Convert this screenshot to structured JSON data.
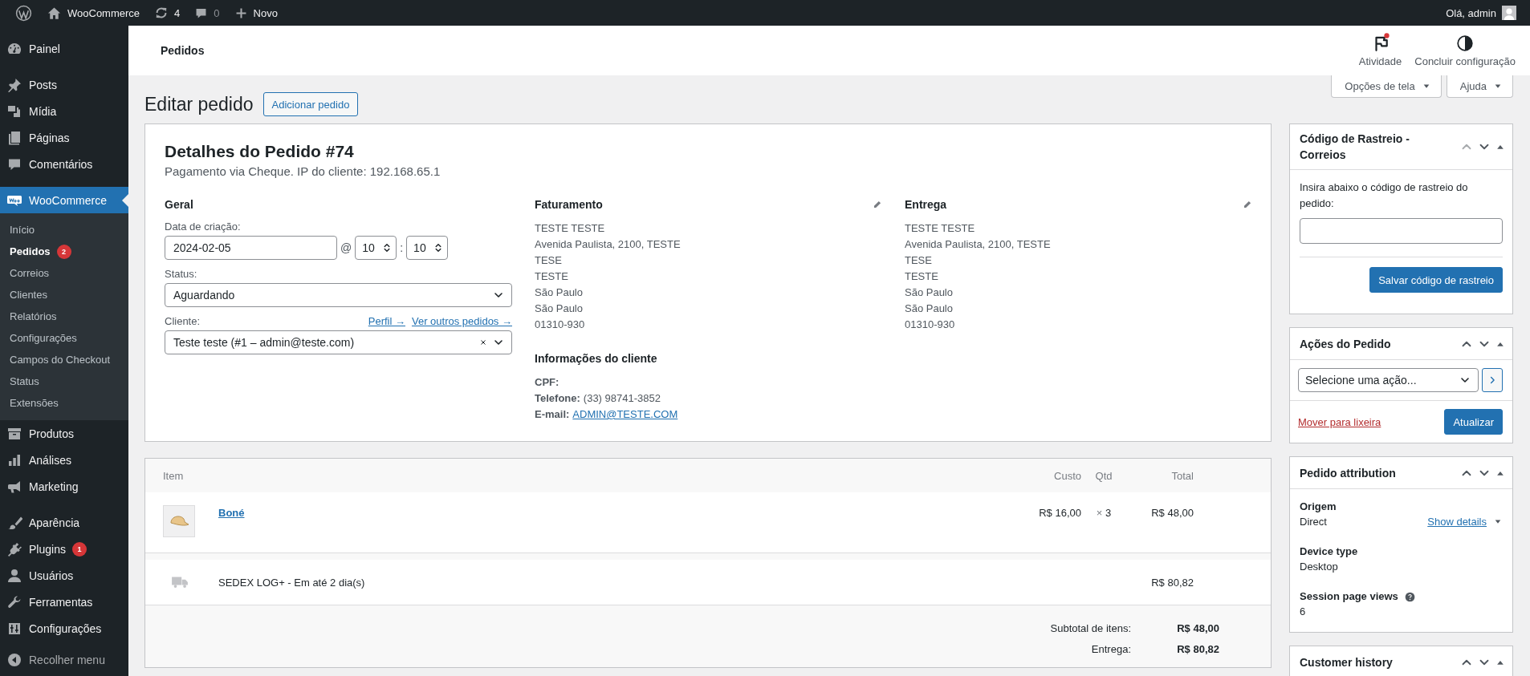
{
  "admin_bar": {
    "site_name": "WooCommerce",
    "updates": "4",
    "comments": "0",
    "new_label": "Novo",
    "greeting": "Olá, admin"
  },
  "menu_groups": [
    {
      "items": [
        {
          "label": "Painel",
          "selected": false
        }
      ]
    },
    {
      "items": [
        {
          "label": "Posts",
          "selected": false
        },
        {
          "label": "Mídia",
          "selected": false
        },
        {
          "label": "Páginas",
          "selected": false
        },
        {
          "label": "Comentários",
          "selected": false
        }
      ]
    },
    {
      "items": [
        {
          "label": "WooCommerce",
          "selected": true,
          "children": [
            {
              "label": "Início",
              "selected": false
            },
            {
              "label": "Pedidos",
              "selected": true,
              "badge": "2"
            },
            {
              "label": "Correios",
              "selected": false
            },
            {
              "label": "Clientes",
              "selected": false
            },
            {
              "label": "Relatórios",
              "selected": false
            },
            {
              "label": "Configurações",
              "selected": false
            },
            {
              "label": "Campos do Checkout",
              "selected": false
            },
            {
              "label": "Status",
              "selected": false
            },
            {
              "label": "Extensões",
              "selected": false
            }
          ]
        },
        {
          "label": "Produtos",
          "selected": false
        },
        {
          "label": "Análises",
          "selected": false
        },
        {
          "label": "Marketing",
          "selected": false
        }
      ]
    },
    {
      "items": [
        {
          "label": "Aparência",
          "selected": false
        },
        {
          "label": "Plugins",
          "selected": false,
          "badge": "1"
        },
        {
          "label": "Usuários",
          "selected": false
        },
        {
          "label": "Ferramentas",
          "selected": false
        },
        {
          "label": "Configurações",
          "selected": false
        }
      ]
    }
  ],
  "collapse_label": "Recolher menu",
  "header": {
    "title": "Pedidos",
    "actions": [
      {
        "label": "Atividade",
        "unread": true
      },
      {
        "label": "Concluir configuração",
        "unread": false
      }
    ]
  },
  "screen_buttons": [
    {
      "label": "Opções de tela"
    },
    {
      "label": "Ajuda"
    }
  ],
  "page": {
    "title": "Editar pedido",
    "add_button": "Adicionar pedido"
  },
  "order": {
    "title": "Detalhes do Pedido #74",
    "subtitle": "Pagamento via Cheque. IP do cliente: 192.168.65.1",
    "general": {
      "heading": "Geral",
      "date_label": "Data de criação:",
      "date": "2024-02-05",
      "at": "@",
      "hour": "10",
      "colon": ":",
      "minute": "10",
      "status_label": "Status:",
      "status": "Aguardando",
      "customer_label": "Cliente:",
      "customer_links": [
        "Perfil →",
        "Ver outros pedidos →"
      ],
      "customer": "Teste teste (#1 – admin@teste.com)"
    },
    "billing": {
      "heading": "Faturamento",
      "address": [
        "TESTE TESTE",
        "Avenida Paulista, 2100, TESTE",
        "TESE",
        "TESTE",
        "São Paulo",
        "São Paulo",
        "01310-930"
      ],
      "info_heading": "Informações do cliente",
      "info": [
        {
          "label": "CPF:",
          "kind": "text"
        },
        {
          "label": "Telefone:",
          "value": "(33) 98741-3852",
          "kind": "text"
        },
        {
          "label": "E-mail:",
          "value": "ADMIN@TESTE.COM",
          "kind": "link"
        }
      ]
    },
    "shipping": {
      "heading": "Entrega",
      "address": [
        "TESTE TESTE",
        "Avenida Paulista, 2100, TESTE",
        "TESE",
        "TESTE",
        "São Paulo",
        "São Paulo",
        "01310-930"
      ]
    }
  },
  "items": {
    "columns": [
      {
        "label": "Item"
      },
      {
        "label": "Custo"
      },
      {
        "label": "Qtd"
      },
      {
        "label": "Total"
      }
    ],
    "rows": [
      {
        "kind": "product",
        "name": "Boné",
        "cost": "R$ 16,00",
        "times": "×",
        "qty": "3",
        "total": "R$ 48,00"
      },
      {
        "kind": "shipping",
        "name": "SEDEX LOG+ - Em até 2 dia(s)",
        "total": "R$ 80,82"
      }
    ],
    "totals": [
      {
        "label": "Subtotal de itens:",
        "value": "R$ 48,00"
      },
      {
        "label": "Entrega:",
        "value": "R$ 80,82"
      }
    ]
  },
  "side_boxes": [
    {
      "kind": "tracking",
      "title": "Código de Rastreio - Correios",
      "up_disabled": true,
      "text": "Insira abaixo o código de rastreio do pedido:",
      "button": "Salvar código de rastreio"
    },
    {
      "kind": "actions",
      "title": "Ações do Pedido",
      "up_disabled": false,
      "select": "Selecione uma ação...",
      "trash_link": "Mover para lixeira",
      "button": "Atualizar"
    },
    {
      "kind": "attribution",
      "title": "Pedido attribution",
      "up_disabled": false,
      "fields": [
        {
          "label": "Origem",
          "value": "Direct",
          "link": "Show details",
          "help": false
        },
        {
          "label": "Device type",
          "value": "Desktop",
          "help": false
        },
        {
          "label": "Session page views",
          "value": "6",
          "help": true
        }
      ]
    },
    {
      "kind": "history",
      "title": "Customer history",
      "up_disabled": false
    }
  ]
}
